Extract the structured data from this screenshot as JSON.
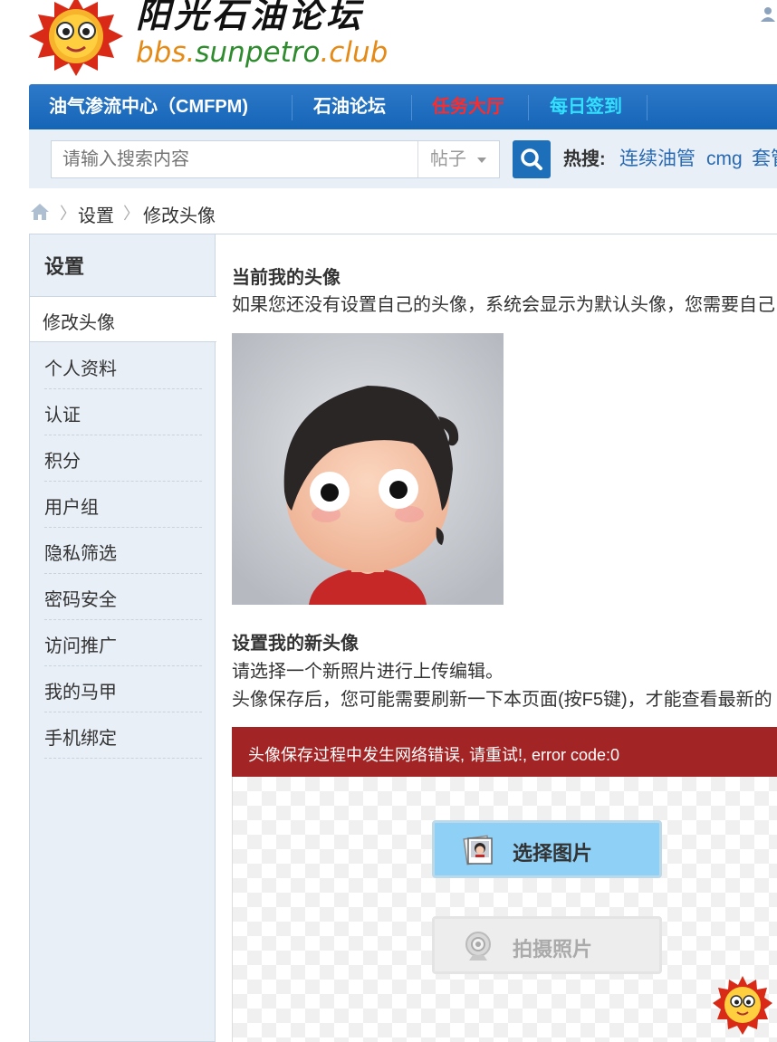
{
  "header": {
    "logo_cn": "阳光石油论坛",
    "logo_url_a": "bbs.",
    "logo_url_b": "sunpetro",
    "logo_url_c": ".club"
  },
  "nav": {
    "items": [
      {
        "label": "油气渗流中心（CMFPM)",
        "color": "#ffffff"
      },
      {
        "label": "石油论坛",
        "color": "#ffffff"
      },
      {
        "label": "任务大厅",
        "color": "#ff2a2a"
      },
      {
        "label": "每日签到",
        "color": "#33e0ff"
      }
    ]
  },
  "search": {
    "placeholder": "请输入搜索内容",
    "type_label": "帖子",
    "hot_label": "热搜:",
    "hot_links": [
      "连续油管",
      "cmg",
      "套管"
    ]
  },
  "breadcrumb": {
    "items": [
      "设置",
      "修改头像"
    ]
  },
  "sidebar": {
    "title": "设置",
    "active": "修改头像",
    "items": [
      "个人资料",
      "认证",
      "积分",
      "用户组",
      "隐私筛选",
      "密码安全",
      "访问推广",
      "我的马甲",
      "手机绑定"
    ]
  },
  "main": {
    "current_title": "当前我的头像",
    "current_desc": "如果您还没有设置自己的头像，系统会显示为默认头像，您需要自己",
    "new_title": "设置我的新头像",
    "new_desc1": "请选择一个新照片进行上传编辑。",
    "new_desc2": "头像保存后，您可能需要刷新一下本页面(按F5键)，才能查看最新的",
    "error_text": "头像保存过程中发生网络错误, 请重试!, error code:0",
    "btn_select": "选择图片",
    "btn_photo": "拍摄照片"
  },
  "colors": {
    "nav_bg": "#1565b7",
    "accent_red": "#ff2a2a",
    "accent_cyan": "#33e0ff",
    "error_bg": "#a32424",
    "link": "#2a6ab0"
  }
}
